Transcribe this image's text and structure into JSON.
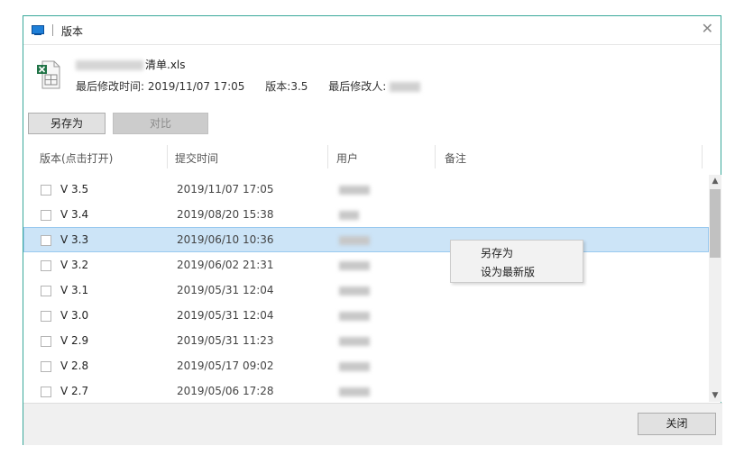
{
  "window": {
    "title": "版本"
  },
  "file": {
    "name_suffix": "清单.xls",
    "modified_time_label": "最后修改时间:",
    "modified_time": "2019/11/07 17:05",
    "version_label": "版本:",
    "version": "3.5",
    "modifier_label": "最后修改人:"
  },
  "toolbar": {
    "save_as_label": "另存为",
    "compare_label": "对比"
  },
  "columns": [
    "版本(点击打开)",
    "提交时间",
    "用户",
    "备注"
  ],
  "rows": [
    {
      "version": "V 3.5",
      "time": "2019/11/07 17:05"
    },
    {
      "version": "V 3.4",
      "time": "2019/08/20 15:38"
    },
    {
      "version": "V 3.3",
      "time": "2019/06/10 10:36"
    },
    {
      "version": "V 3.2",
      "time": "2019/06/02 21:31"
    },
    {
      "version": "V 3.1",
      "time": "2019/05/31 12:04"
    },
    {
      "version": "V 3.0",
      "time": "2019/05/31 12:04"
    },
    {
      "version": "V 2.9",
      "time": "2019/05/31 11:23"
    },
    {
      "version": "V 2.8",
      "time": "2019/05/17 09:02"
    },
    {
      "version": "V 2.7",
      "time": "2019/05/06 17:28"
    }
  ],
  "context_menu": {
    "items": [
      "另存为",
      "设为最新版"
    ]
  },
  "footer": {
    "close_label": "关闭"
  },
  "colors": {
    "selection": "#cce4f7",
    "window_border": "#3aa89a",
    "excel_green": "#1f7346"
  },
  "icons": [
    "app-window-icon",
    "close-icon",
    "excel-file-icon",
    "scroll-up-icon",
    "scroll-down-icon"
  ]
}
